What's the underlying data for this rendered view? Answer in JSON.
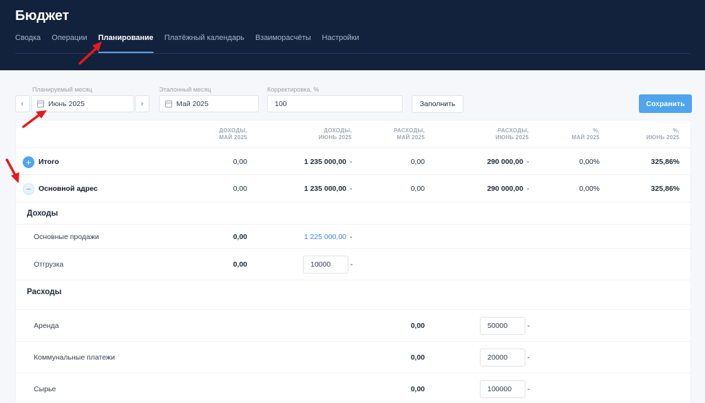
{
  "header": {
    "title": "Бюджет",
    "tabs": [
      "Сводка",
      "Операции",
      "Планирование",
      "Платёжный календарь",
      "Взаиморасчёты",
      "Настройки"
    ],
    "active_tab": "Планирование"
  },
  "filters": {
    "planned_month_label": "Планируемый месяц",
    "planned_month_value": "Июнь 2025",
    "reference_month_label": "Эталонный месяц",
    "reference_month_value": "Май 2025",
    "correction_label": "Корректировка, %",
    "correction_value": "100",
    "fill_button": "Заполнить",
    "save_button": "Сохранить",
    "prev_icon": "chevron-left-icon",
    "next_icon": "chevron-right-icon",
    "calendar_icon": "calendar-icon"
  },
  "table": {
    "columns": [
      {
        "line1": "ДОХОДЫ,",
        "line2": "МАЙ 2025"
      },
      {
        "line1": "ДОХОДЫ,",
        "line2": "ИЮНЬ 2025"
      },
      {
        "line1": "РАСХОДЫ,",
        "line2": "МАЙ 2025"
      },
      {
        "line1": "РАСХОДЫ,",
        "line2": "ИЮНЬ 2025"
      },
      {
        "line1": "%,",
        "line2": "МАЙ 2025"
      },
      {
        "line1": "%,",
        "line2": "ИЮНЬ 2025"
      }
    ],
    "total": {
      "label": "Итого",
      "income_may": "0,00",
      "income_june": "1 235 000,00",
      "expense_may": "0,00",
      "expense_june": "290 000,00",
      "pct_may": "0,00%",
      "pct_june": "325,86%"
    },
    "main_address": {
      "label": "Основной адрес",
      "income_may": "0,00",
      "income_june": "1 235 000,00",
      "expense_may": "0,00",
      "expense_june": "290 000,00",
      "pct_may": "0,00%",
      "pct_june": "325,86%"
    },
    "dash": "-",
    "income_section": "Доходы",
    "income_items": [
      {
        "label": "Основные продажи",
        "may": "0,00",
        "june": "1 225 000,00"
      },
      {
        "label": "Отгрузка",
        "may": "0,00",
        "june_input": "10000"
      }
    ],
    "expense_section": "Расходы",
    "expense_items": [
      {
        "label": "Аренда",
        "may": "0,00",
        "june_input": "50000"
      },
      {
        "label": "Коммунальные платежи",
        "may": "0,00",
        "june_input": "20000"
      },
      {
        "label": "Сырье",
        "may": "0,00",
        "june_input": "100000"
      }
    ]
  },
  "colors": {
    "header_bg": "#12223d",
    "accent": "#4ea5ee",
    "annotation_arrow": "#e8191b"
  }
}
